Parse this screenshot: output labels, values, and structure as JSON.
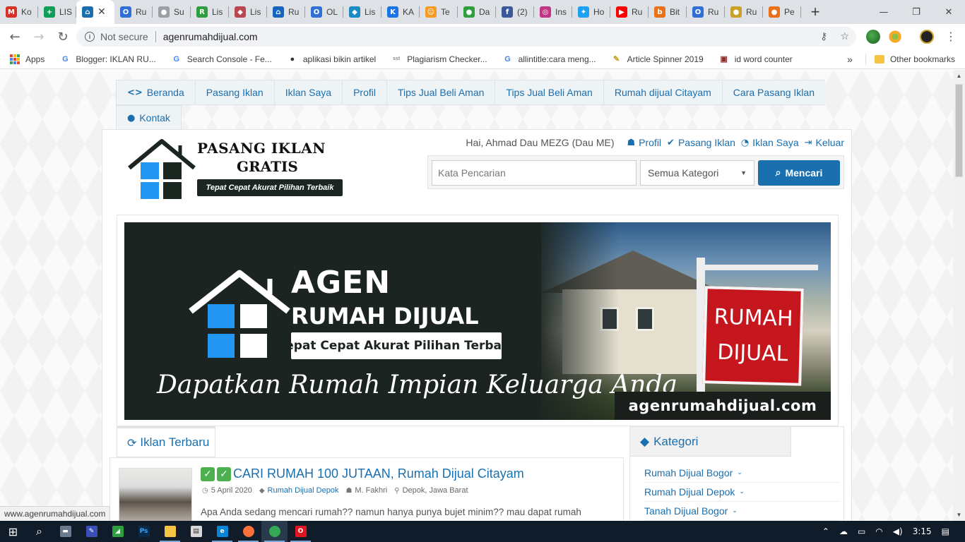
{
  "browser": {
    "tabs": [
      {
        "title": "Ko",
        "icon": "gmail-icon",
        "color": "#d93025",
        "glyph": "M"
      },
      {
        "title": "LIS",
        "icon": "sheets-plus-icon",
        "color": "#0f9d58",
        "glyph": "+"
      },
      {
        "title": "",
        "icon": "house-icon",
        "color": "#1a6fae",
        "glyph": "⌂",
        "active": true
      },
      {
        "title": "Ru",
        "icon": "olx-icon",
        "color": "#2f6fd6",
        "glyph": "O"
      },
      {
        "title": "Su",
        "icon": "globe-icon",
        "color": "#9aa0a6",
        "glyph": "●"
      },
      {
        "title": "Lis",
        "icon": "r-icon",
        "color": "#2e9e3e",
        "glyph": "R"
      },
      {
        "title": "Lis",
        "icon": "diamond-icon",
        "color": "#b9474f",
        "glyph": "◆"
      },
      {
        "title": "Ru",
        "icon": "house-blue-icon",
        "color": "#1565c0",
        "glyph": "⌂"
      },
      {
        "title": "OL",
        "icon": "olx-icon",
        "color": "#2f6fd6",
        "glyph": "O"
      },
      {
        "title": "Lis",
        "icon": "tag-icon",
        "color": "#1a8bc4",
        "glyph": "◆"
      },
      {
        "title": "KA",
        "icon": "k-icon",
        "color": "#1a73e8",
        "glyph": "K"
      },
      {
        "title": "Te",
        "icon": "face-icon",
        "color": "#f59a23",
        "glyph": "☺"
      },
      {
        "title": "Da",
        "icon": "phone-icon",
        "color": "#2e9e3e",
        "glyph": "●"
      },
      {
        "title": "(2)",
        "icon": "facebook-icon",
        "color": "#3b5998",
        "glyph": "f"
      },
      {
        "title": "Ins",
        "icon": "instagram-icon",
        "color": "#c13584",
        "glyph": "◎"
      },
      {
        "title": "Ho",
        "icon": "twitter-icon",
        "color": "#1da1f2",
        "glyph": "✦"
      },
      {
        "title": "Ru",
        "icon": "youtube-icon",
        "color": "#ff0000",
        "glyph": "▶"
      },
      {
        "title": "Bit",
        "icon": "b-icon",
        "color": "#e8711a",
        "glyph": "b"
      },
      {
        "title": "Ru",
        "icon": "olx-icon",
        "color": "#2f6fd6",
        "glyph": "O"
      },
      {
        "title": "Ru",
        "icon": "gold-icon",
        "color": "#c9a227",
        "glyph": "●"
      },
      {
        "title": "Pe",
        "icon": "circle-red-icon",
        "color": "#e8711a",
        "glyph": "●"
      }
    ],
    "close_glyph": "✕",
    "newtab_glyph": "+",
    "window": {
      "minimize": "—",
      "restore": "❐",
      "close": "✕"
    },
    "nav": {
      "back": "←",
      "forward": "→",
      "reload": "↻"
    },
    "security_label": "Not secure",
    "url": "agenrumahdijual.com",
    "key_glyph": "⚷",
    "star_glyph": "☆",
    "menu_glyph": "⋮",
    "bookmarks": [
      {
        "label": "Apps",
        "icon": "apps-grid-icon"
      },
      {
        "label": "Blogger: IKLAN RU...",
        "icon": "google-icon"
      },
      {
        "label": "Search Console - Fe...",
        "icon": "google-icon"
      },
      {
        "label": "aplikasi bikin artikel",
        "icon": "globe-dark-icon"
      },
      {
        "label": "Plagiarism Checker...",
        "icon": "sst-icon"
      },
      {
        "label": "allintitle:cara meng...",
        "icon": "google-icon"
      },
      {
        "label": "Article Spinner 2019",
        "icon": "spinner-icon"
      },
      {
        "label": "id word counter",
        "icon": "counter-icon"
      }
    ],
    "bookmarks_overflow": "»",
    "other_bookmarks": "Other bookmarks",
    "status_url": "www.agenrumahdijual.com"
  },
  "site": {
    "nav": [
      {
        "label": "Beranda",
        "icon": "code-icon"
      },
      {
        "label": "Pasang Iklan"
      },
      {
        "label": "Iklan Saya"
      },
      {
        "label": "Profil"
      },
      {
        "label": "Tips Jual Beli Aman"
      },
      {
        "label": "Tips Jual Beli Aman"
      },
      {
        "label": "Rumah dijual Citayam"
      },
      {
        "label": "Cara Pasang Iklan"
      },
      {
        "label": "Kontak",
        "icon": "chat-icon"
      }
    ],
    "logo": {
      "line1": "PASANG IKLAN",
      "line2": "GRATIS",
      "tagline": "Tepat Cepat Akurat Pilihan Terbaik"
    },
    "greeting": "Hai, Ahmad Dau MEZG (Dau ME)",
    "user_links": [
      {
        "label": "Profil",
        "icon": "user-icon"
      },
      {
        "label": "Pasang Iklan",
        "icon": "check-circle-icon"
      },
      {
        "label": "Iklan Saya",
        "icon": "rss-icon"
      },
      {
        "label": "Keluar",
        "icon": "logout-icon"
      }
    ],
    "search": {
      "placeholder": "Kata Pencarian",
      "category": "Semua Kategori",
      "button": "Mencari"
    },
    "banner": {
      "title": "AGEN",
      "subtitle": "RUMAH DIJUAL",
      "tagline": "Tepat Cepat Akurat Pilihan Terbaik",
      "slogan": "Dapatkan Rumah Impian Keluarga Anda",
      "sign_line1": "RUMAH",
      "sign_line2": "DIJUAL",
      "domain": "agenrumahdijual.com"
    },
    "latest": {
      "heading": "Iklan Terbaru",
      "listing": {
        "title": "CARI RUMAH 100 JUTAAN, Rumah Dijual Citayam",
        "date": "5 April 2020",
        "category": "Rumah Dijual Depok",
        "author": "M. Fakhri",
        "location": "Depok, Jawa Barat",
        "excerpt": "Apa Anda sedang mencari rumah?? namun hanya punya bujet minim?? mau dapat rumah"
      }
    },
    "categories": {
      "heading": "Kategori",
      "items": [
        "Rumah Dijual Bogor",
        "Rumah Dijual Depok",
        "Tanah Dijual Bogor"
      ]
    }
  },
  "taskbar": {
    "time": "3:15",
    "apps": [
      {
        "icon": "windows-start-icon"
      },
      {
        "icon": "search-icon"
      },
      {
        "icon": "file-explorer-icon"
      },
      {
        "icon": "paint-icon"
      },
      {
        "icon": "green-app-icon"
      },
      {
        "icon": "photoshop-icon"
      },
      {
        "icon": "folder-icon"
      },
      {
        "icon": "notepad-icon"
      },
      {
        "icon": "edge-icon"
      },
      {
        "icon": "firefox-icon"
      },
      {
        "icon": "chrome-icon"
      },
      {
        "icon": "opera-icon"
      }
    ]
  },
  "colors": {
    "brand_blue": "#1a6fae",
    "banner_dark": "#1c2421",
    "sign_red": "#c4161c",
    "taskbar": "#101c2a"
  }
}
